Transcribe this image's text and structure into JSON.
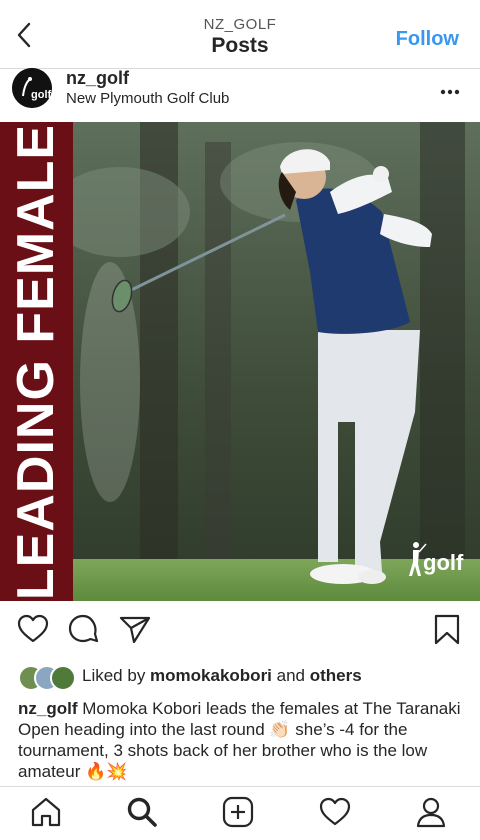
{
  "nav": {
    "subtitle": "NZ_GOLF",
    "title": "Posts",
    "follow_label": "Follow"
  },
  "post": {
    "username": "nz_golf",
    "location": "New Plymouth Golf Club",
    "image_banner_text": "LEADING FEMALE",
    "image_logo_text": "golf",
    "likes": {
      "prefix": "Liked by ",
      "user": "momokakobori",
      "middle": " and ",
      "others": "others"
    },
    "caption": {
      "username": "nz_golf",
      "text": " Momoka Kobori leads the females at The Taranaki Open heading into the last round 👏🏻 she’s -4 for the tournament, 3 shots back of her brother who is the low amateur 🔥💥"
    }
  },
  "colors": {
    "accent": "#3897f0",
    "banner": "#6a0f15"
  },
  "icons": {
    "back": "chevron-left-icon",
    "more": "more-horizontal-icon",
    "like": "heart-icon",
    "comment": "comment-icon",
    "share": "send-icon",
    "save": "bookmark-icon",
    "tabs": [
      "home-icon",
      "search-icon",
      "add-post-icon",
      "activity-heart-icon",
      "profile-icon"
    ]
  }
}
